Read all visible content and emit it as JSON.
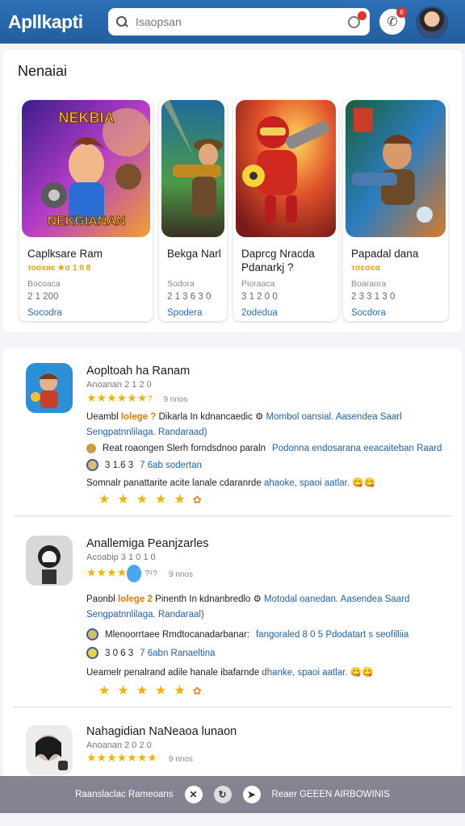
{
  "header": {
    "app_name": "Apllkapti",
    "search_placeholder": "Isaopsan",
    "notif_count": "6"
  },
  "featured": {
    "title": "Nenaiai",
    "cards": [
      {
        "art_title": "NEKBIA",
        "art_sub": "NEKGIANAN",
        "title_1": "Caplksare Ram",
        "title_2": "",
        "stars": "тоσєяє ★σ 1 0 8",
        "meta": "Bocoaca",
        "price": "2 1 200",
        "action": "Socodra"
      },
      {
        "art_title": "",
        "art_sub": "",
        "title_1": "Bekga Narl",
        "title_2": "",
        "stars": "",
        "meta": "Sodora",
        "price": "2 1 3 6 3 0",
        "action": "Spodera"
      },
      {
        "art_title": "",
        "art_sub": "",
        "title_1": "Daprcg Nracda",
        "title_2": "Pdanarkj ?",
        "stars": "",
        "meta": "Pioraaca",
        "price": "3 1 2 0 0",
        "action": "2odedua"
      },
      {
        "art_title": "",
        "art_sub": "",
        "title_1": "Papadal dana",
        "title_2": "",
        "stars": "тσєσєα",
        "meta": "Boaraora",
        "price": "2 3 3 1 3 0",
        "action": "Socdora"
      }
    ]
  },
  "list": [
    {
      "name": "Aopltoah ha Ranam",
      "sub": "Anoanan 2 1 2 0",
      "rating_count": "9 nnos",
      "desc_1a": "Ueambl",
      "desc_1hl": "lolege ?",
      "desc_1b": "Dikarla In kdnancaedic",
      "desc_1link": "Mombol oansial.  Aasendea Saarl",
      "desc_2": "Sengpatnnlilaga.  Randaraad)",
      "row_1a": "Reat roaongen Slerh forndsdnoo paraln",
      "row_1link": "Podonna endosarana eeacaiteban Raard",
      "row_2a": "3 1.6 3",
      "row_2link": "7 6ab sodertan",
      "footer_a": "Somnalr panattarite acite lanale cdaranrde",
      "footer_link": "ahaoke, spaoi aatlar.",
      "footer_b": ""
    },
    {
      "name": "Anallemiga Peanjzarles",
      "sub": "Acoabip 3 1 0 1 0",
      "rating_count": "9 nnos",
      "desc_1a": "Paonbl",
      "desc_1hl": "lolege 2",
      "desc_1b": "Pinenth In kdnanbredlo",
      "desc_1link": "Motodal oanedan.  Aasendea Saard",
      "desc_2": "Sengpatnnlilaga.  Randaraal)",
      "row_1a": "Mlenoorrtaee Rmdtocanadarbanar:",
      "row_1link": "fangoraled 8 0 5   Pdodatart  s seofilliia",
      "row_2a": "3 0 6 3",
      "row_2link": "7 6abn Ranaeltina",
      "footer_a": "Ueamelr penalrand adile hanale ibafarnde",
      "footer_link": "dhanke, spaoi aatlar.",
      "footer_b": ""
    },
    {
      "name": "Nahagidian NaNeaoa lunaon",
      "sub": "Anoanan 2 0 2 0",
      "rating_count": "9 nnos"
    }
  ],
  "bottom_bar": {
    "left_label": "Raanslaclac Rameoans",
    "right_label": "Reaer  GEEEN AIRBOWINIS"
  },
  "colors": {
    "header_blue": "#2c6fb6",
    "link_blue": "#2360a8",
    "star_gold": "#f0b400",
    "highlight_orange": "#e07b00"
  }
}
